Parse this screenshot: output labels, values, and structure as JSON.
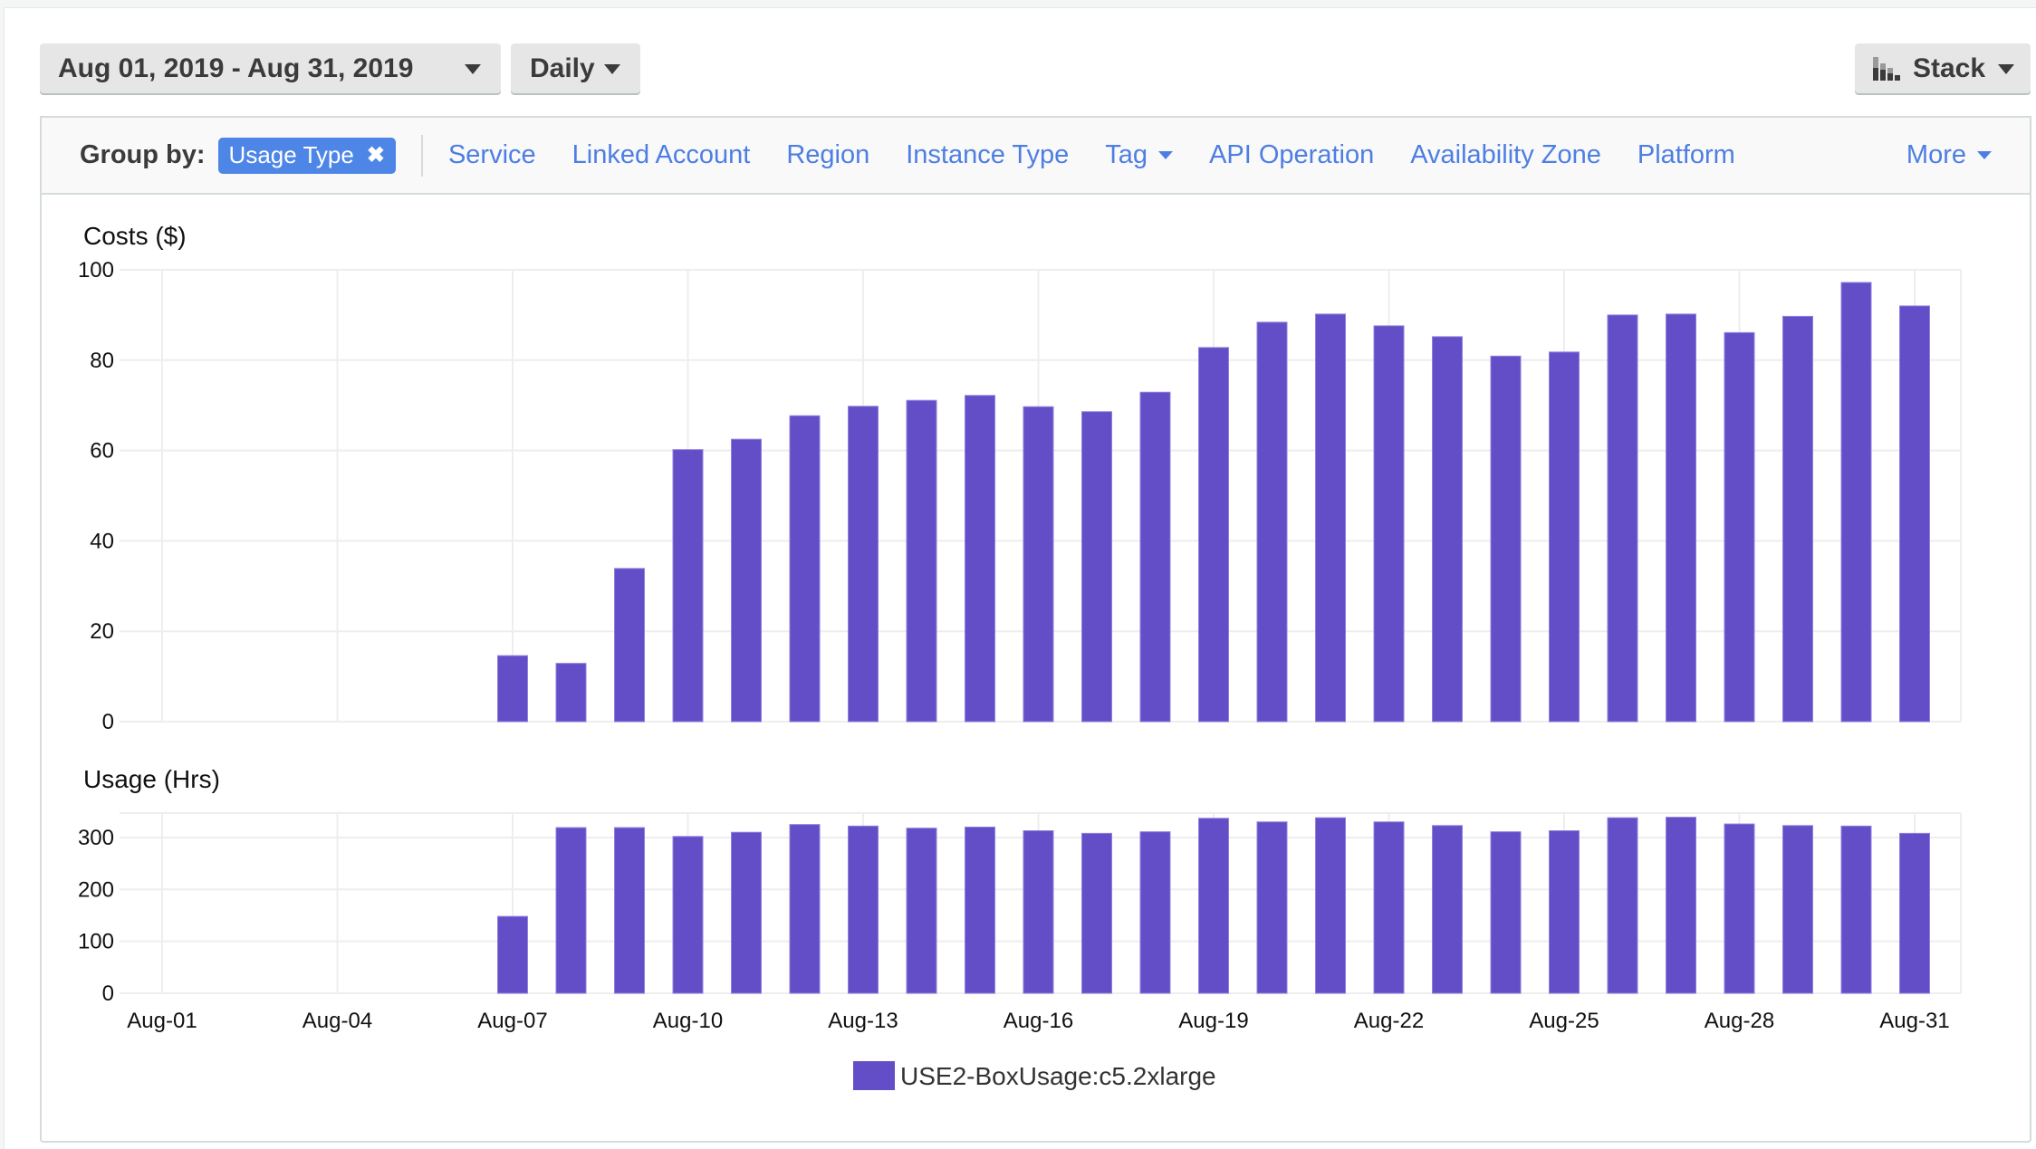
{
  "toolbar": {
    "date_range": "Aug 01, 2019 - Aug 31, 2019",
    "interval": "Daily",
    "chart_style": "Stack"
  },
  "group_by": {
    "label": "Group by:",
    "active_chip": "Usage Type",
    "options": [
      "Service",
      "Linked Account",
      "Region",
      "Instance Type",
      "Tag",
      "API Operation",
      "Availability Zone",
      "Platform"
    ],
    "more": "More"
  },
  "colors": {
    "series": "#634ec7",
    "chip": "#4d86e6",
    "link": "#4d7ee3"
  },
  "chart_data": [
    {
      "type": "bar",
      "title": "Costs ($)",
      "xlabel": "",
      "ylabel": "Costs ($)",
      "ylim": [
        0,
        100
      ],
      "yticks": [
        0,
        20,
        40,
        60,
        80,
        100
      ],
      "grid": true,
      "categories": [
        "Aug-01",
        "Aug-02",
        "Aug-03",
        "Aug-04",
        "Aug-05",
        "Aug-06",
        "Aug-07",
        "Aug-08",
        "Aug-09",
        "Aug-10",
        "Aug-11",
        "Aug-12",
        "Aug-13",
        "Aug-14",
        "Aug-15",
        "Aug-16",
        "Aug-17",
        "Aug-18",
        "Aug-19",
        "Aug-20",
        "Aug-21",
        "Aug-22",
        "Aug-23",
        "Aug-24",
        "Aug-25",
        "Aug-26",
        "Aug-27",
        "Aug-28",
        "Aug-29",
        "Aug-30",
        "Aug-31"
      ],
      "xtick_labels": [
        "Aug-01",
        "Aug-04",
        "Aug-07",
        "Aug-10",
        "Aug-13",
        "Aug-16",
        "Aug-19",
        "Aug-22",
        "Aug-25",
        "Aug-28",
        "Aug-31"
      ],
      "series": [
        {
          "name": "USE2-BoxUsage:c5.2xlarge",
          "values": [
            0,
            0,
            0,
            0,
            0,
            0,
            14.6,
            12.9,
            33.9,
            60.2,
            62.5,
            67.7,
            69.8,
            71.1,
            72.2,
            69.7,
            68.6,
            72.9,
            82.8,
            88.4,
            90.2,
            87.6,
            85.2,
            80.9,
            81.8,
            90.0,
            90.2,
            86.1,
            89.7,
            97.2,
            92.0
          ]
        }
      ]
    },
    {
      "type": "bar",
      "title": "Usage (Hrs)",
      "xlabel": "",
      "ylabel": "Usage (Hrs)",
      "ylim": [
        0,
        347
      ],
      "yticks": [
        0,
        100,
        200,
        300
      ],
      "grid": true,
      "categories": [
        "Aug-01",
        "Aug-02",
        "Aug-03",
        "Aug-04",
        "Aug-05",
        "Aug-06",
        "Aug-07",
        "Aug-08",
        "Aug-09",
        "Aug-10",
        "Aug-11",
        "Aug-12",
        "Aug-13",
        "Aug-14",
        "Aug-15",
        "Aug-16",
        "Aug-17",
        "Aug-18",
        "Aug-19",
        "Aug-20",
        "Aug-21",
        "Aug-22",
        "Aug-23",
        "Aug-24",
        "Aug-25",
        "Aug-26",
        "Aug-27",
        "Aug-28",
        "Aug-29",
        "Aug-30",
        "Aug-31"
      ],
      "xtick_labels": [
        "Aug-01",
        "Aug-04",
        "Aug-07",
        "Aug-10",
        "Aug-13",
        "Aug-16",
        "Aug-19",
        "Aug-22",
        "Aug-25",
        "Aug-28",
        "Aug-31"
      ],
      "series": [
        {
          "name": "USE2-BoxUsage:c5.2xlarge",
          "values": [
            0,
            0,
            0,
            0,
            0,
            0,
            148,
            319,
            319,
            302,
            310,
            325,
            322,
            318,
            320,
            313,
            308,
            311,
            337,
            330,
            338,
            330,
            323,
            311,
            313,
            338,
            339,
            326,
            323,
            322,
            308
          ]
        }
      ]
    }
  ],
  "legend": {
    "position": "bottom-center",
    "items": [
      {
        "label": "USE2-BoxUsage:c5.2xlarge",
        "color": "#634ec7"
      }
    ]
  }
}
